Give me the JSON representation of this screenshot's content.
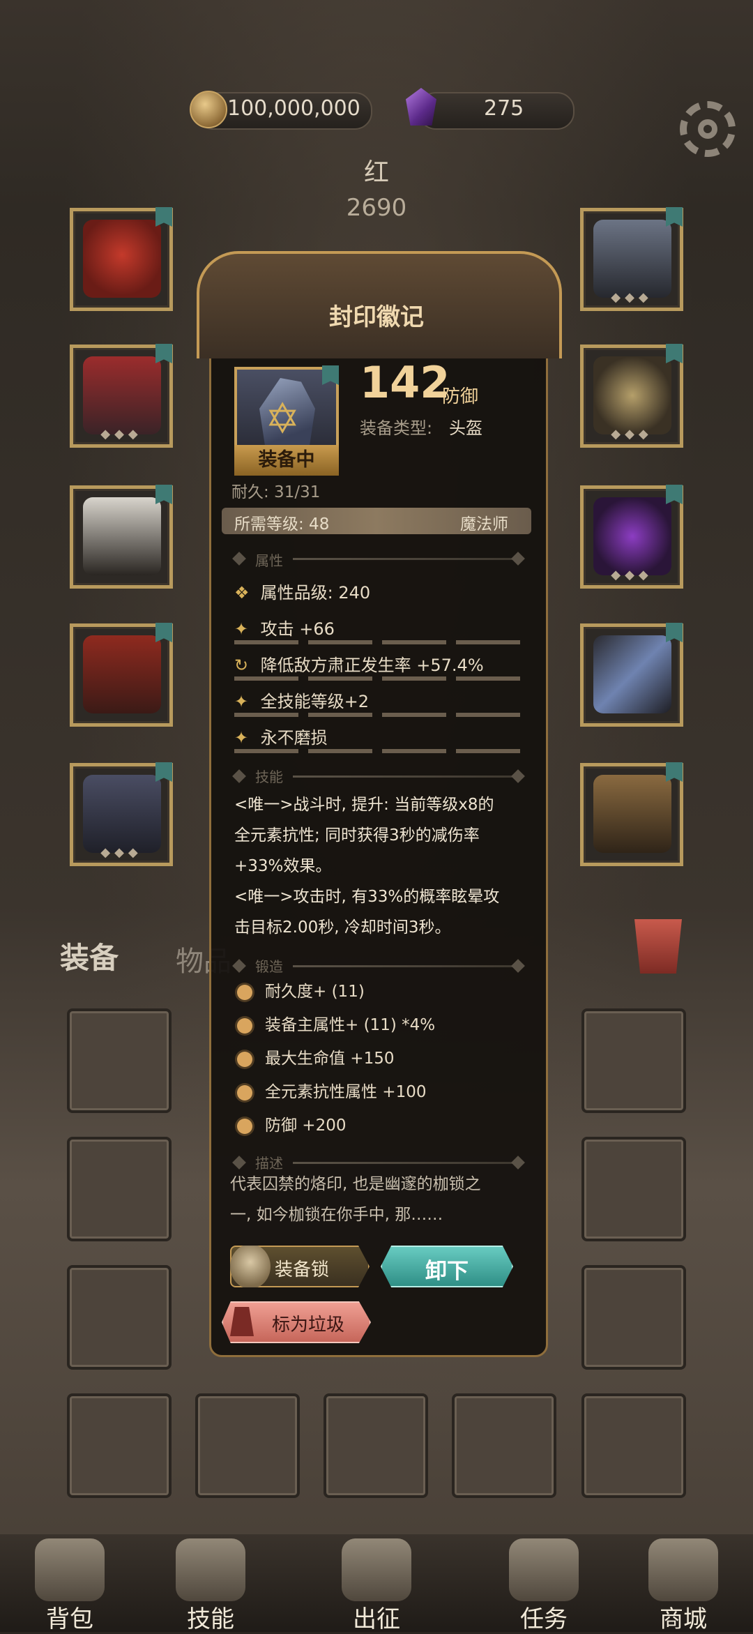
{
  "currency": {
    "gold": "100,000,000",
    "gems": "275"
  },
  "hero": {
    "name": "红",
    "power": "2690"
  },
  "item": {
    "title": "封印徽记",
    "stat_value": "142",
    "stat_name": "防御",
    "type_label": "装备类型:",
    "type_value": "头盔",
    "equipped_badge": "装备中",
    "durability": "耐久: 31/31",
    "required_level": "所需等级: 48",
    "class": "魔法师",
    "sections": {
      "attributes": "属性",
      "skills": "技能",
      "forge": "锻造",
      "description": "描述"
    },
    "attributes": [
      {
        "icon": "rank-icon",
        "text": "属性品级: 240"
      },
      {
        "icon": "sparkle-icon",
        "text": "攻击 +66"
      },
      {
        "icon": "cycle-icon",
        "text": "降低敌方肃正发生率 +57.4%"
      },
      {
        "icon": "sparkle-icon",
        "text": "全技能等级+2"
      },
      {
        "icon": "sparkle-icon",
        "text": "永不磨损"
      }
    ],
    "skills": [
      "<唯一>战斗时, 提升: 当前等级x8的",
      "全元素抗性; 同时获得3秒的减伤率",
      "+33%效果。",
      "<唯一>攻击时, 有33%的概率眩晕攻",
      "击目标2.00秒, 冷却时间3秒。"
    ],
    "forge": [
      "耐久度+ (11)",
      "装备主属性+ (11) *4%",
      "最大生命值 +150",
      "全元素抗性属性 +100",
      "防御 +200"
    ],
    "description": [
      "代表囚禁的烙印, 也是幽邃的枷锁之",
      "一, 如今枷锁在你手中, 那……"
    ],
    "buttons": {
      "lock": "装备锁",
      "unequip": "卸下",
      "junk": "标为垃圾"
    }
  },
  "bag": {
    "tabs": [
      "装备",
      "物品"
    ]
  },
  "nav": [
    "背包",
    "技能",
    "出征",
    "任务",
    "商城"
  ],
  "colors": {
    "accent": "#d9b25a",
    "unequip": "#3fa79c",
    "junk": "#d9776b",
    "slot_tag": "#3f7a74"
  }
}
